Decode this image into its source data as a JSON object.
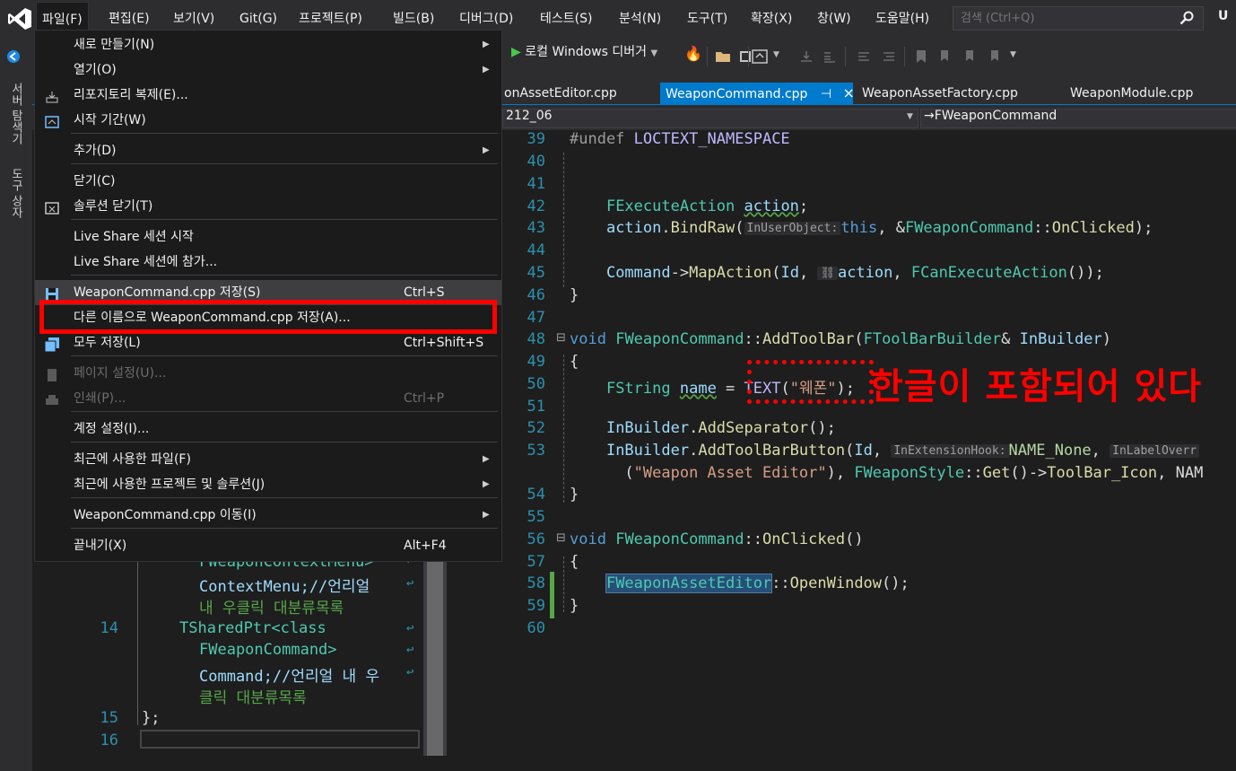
{
  "menubar": {
    "items": [
      "파일(F)",
      "편집(E)",
      "보기(V)",
      "Git(G)",
      "프로젝트(P)",
      "빌드(B)",
      "디버그(D)",
      "테스트(S)",
      "분석(N)",
      "도구(T)",
      "확장(X)",
      "창(W)",
      "도움말(H)"
    ],
    "search_placeholder": "검색 (Ctrl+Q)",
    "user_initial": "U"
  },
  "toolbar": {
    "run_label": "로컬 Windows 디버거"
  },
  "rail": {
    "server_explorer": "서버 탐색기",
    "toolbox": "도구 상자"
  },
  "tabs": [
    {
      "label": "onAssetEditor.cpp"
    },
    {
      "label": "WeaponCommand.cpp",
      "pin": "⊣",
      "close": "×"
    },
    {
      "label": "WeaponAssetFactory.cpp"
    },
    {
      "label": "WeaponModule.cpp"
    }
  ],
  "navbar": {
    "scope": "212_06",
    "member": "FWeaponCommand"
  },
  "file_menu": {
    "items": [
      {
        "label": "새로 만들기(N)",
        "submenu": true
      },
      {
        "label": "열기(O)",
        "submenu": true
      },
      {
        "label": "리포지토리 복제(E)...",
        "icon": "clone-icon"
      },
      {
        "label": "시작 기간(W)",
        "icon": "start-window-icon"
      },
      {
        "label": "추가(D)",
        "submenu": true
      },
      {
        "label": "닫기(C)"
      },
      {
        "label": "솔루션 닫기(T)",
        "icon": "close-solution-icon"
      },
      {
        "label": "Live Share 세션 시작"
      },
      {
        "label": "Live Share 세션에 참가..."
      },
      {
        "label": "WeaponCommand.cpp 저장(S)",
        "shortcut": "Ctrl+S",
        "icon": "save-icon"
      },
      {
        "label": "다른 이름으로 WeaponCommand.cpp 저장(A)..."
      },
      {
        "label": "모두 저장(L)",
        "shortcut": "Ctrl+Shift+S",
        "icon": "save-all-icon"
      },
      {
        "label": "페이지 설정(U)...",
        "disabled": true,
        "icon": "page-setup-icon"
      },
      {
        "label": "인쇄(P)...",
        "shortcut": "Ctrl+P",
        "disabled": true,
        "icon": "print-icon"
      },
      {
        "label": "계정 설정(I)..."
      },
      {
        "label": "최근에 사용한 파일(F)",
        "submenu": true
      },
      {
        "label": "최근에 사용한 프로젝트 및 솔루션(J)",
        "submenu": true
      },
      {
        "label": "WeaponCommand.cpp 이동(I)",
        "submenu": true
      },
      {
        "label": "끝내기(X)",
        "shortcut": "Alt+F4"
      }
    ]
  },
  "editor": {
    "line_numbers": [
      "39",
      "40",
      "41",
      "42",
      "43",
      "44",
      "45",
      "46",
      "47",
      "48",
      "49",
      "50",
      "51",
      "52",
      "53",
      "54",
      "55",
      "56",
      "57",
      "58",
      "59",
      "60"
    ],
    "hints": {
      "in_user_object": "InUserObject:",
      "in_extension_hook": "InExtensionHook:",
      "in_label_override": "InLabelOverr"
    }
  },
  "left_pane": {
    "line_numbers": [
      "14",
      "15",
      "16"
    ],
    "lines": [
      "FWeaponContextMenu>",
      "ContextMenu;//언리얼",
      "내 우클릭 대분류목록",
      "TSharedPtr<class",
      "FWeaponCommand>",
      "Command;//언리얼 내 우",
      "클릭 대분류목록",
      "};"
    ]
  },
  "annotation": {
    "text": "한글이 포함되어 있다"
  },
  "colors": {
    "accent": "#007acc",
    "highlight_red": "#ff0000",
    "menu_bg": "#1b1b1c",
    "editor_bg": "#1e1e1e"
  }
}
